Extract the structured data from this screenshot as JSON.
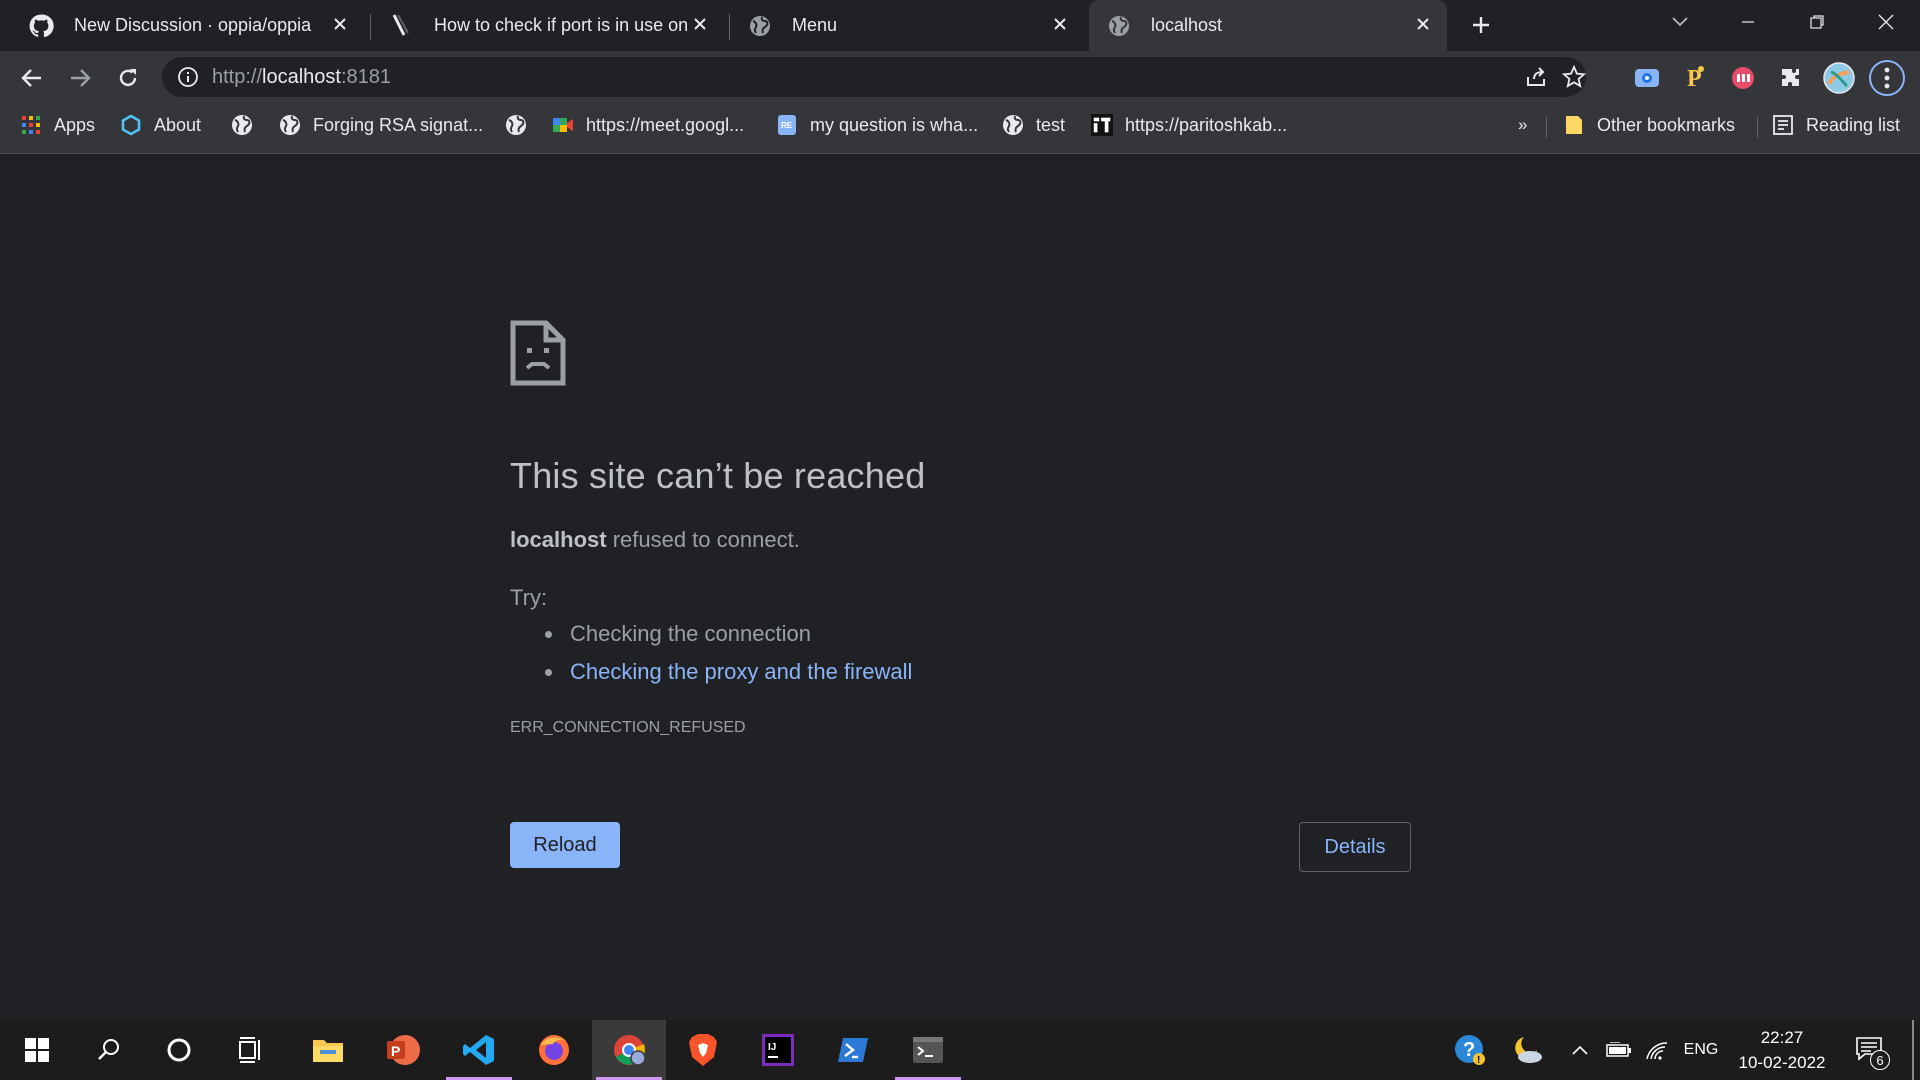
{
  "tabs": [
    {
      "title": "New Discussion · oppia/oppia",
      "icon": "github-icon"
    },
    {
      "title": "How to check if port is in use on",
      "icon": "stackoverflow-icon"
    },
    {
      "title": "Menu",
      "icon": "globe-icon"
    },
    {
      "title": "localhost",
      "icon": "globe-icon",
      "active": true
    }
  ],
  "toolbar": {
    "url_scheme": "http://",
    "url_host": "localhost",
    "url_port": ":8181"
  },
  "bookmarks": {
    "items": [
      {
        "label": "Apps",
        "icon": "apps-grid-icon"
      },
      {
        "label": "About",
        "icon": "hexagon-icon"
      },
      {
        "label": "",
        "icon": "globe-icon"
      },
      {
        "label": "Forging RSA signat...",
        "icon": "globe-icon"
      },
      {
        "label": "",
        "icon": "globe-icon"
      },
      {
        "label": "https://meet.googl...",
        "icon": "google-meet-icon"
      },
      {
        "label": "my question is wha...",
        "icon": "doc-icon"
      },
      {
        "label": "test",
        "icon": "globe-icon"
      },
      {
        "label": "https://paritoshkab...",
        "icon": "site-logo-icon"
      }
    ],
    "overflow": "»",
    "other": "Other bookmarks",
    "reading_list": "Reading list"
  },
  "error": {
    "title": "This site can’t be reached",
    "host": "localhost",
    "message": " refused to connect.",
    "try_label": "Try:",
    "suggestions": [
      "Checking the connection",
      "Checking the proxy and the firewall"
    ],
    "code": "ERR_CONNECTION_REFUSED",
    "reload_label": "Reload",
    "details_label": "Details"
  },
  "taskbar": {
    "language": "ENG",
    "time": "22:27",
    "date": "10-02-2022",
    "notification_count": "6"
  },
  "colors": {
    "link": "#8ab4f8",
    "background": "#202124",
    "toolbar": "#35363a"
  }
}
